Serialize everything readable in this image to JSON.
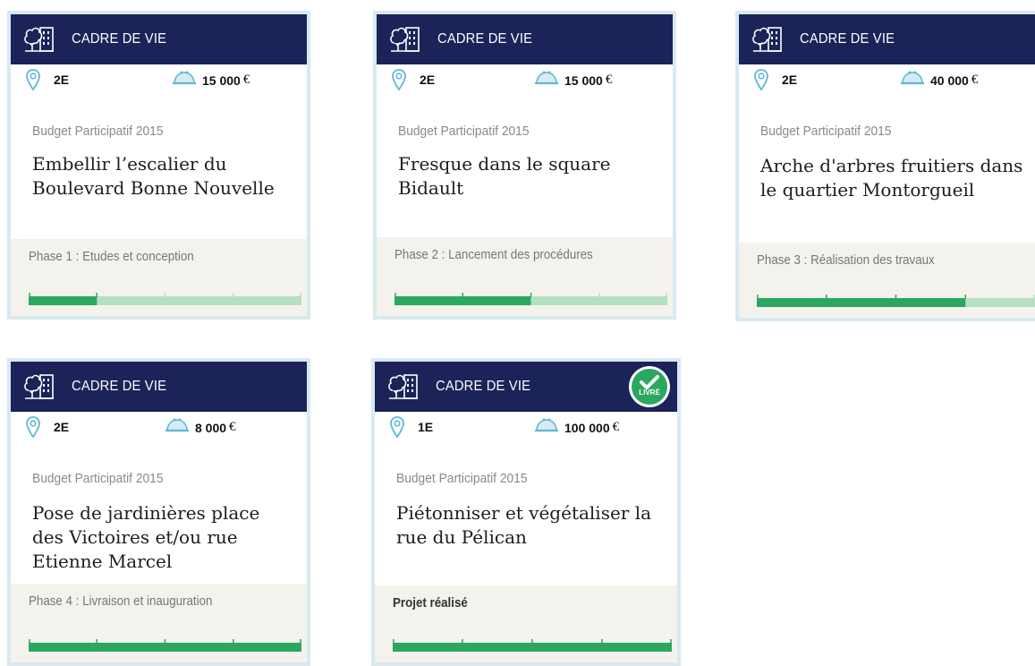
{
  "colors": {
    "header": "#1b2359",
    "accent": "#2aa860",
    "track": "#b6dfc3",
    "pin": "#5fb8d5",
    "purse": "#5fb8d5",
    "phase_bg": "#f4f2ed",
    "border": "#d7eaf0"
  },
  "icons": {
    "category": "tree-building-icon",
    "location": "map-pin-icon",
    "budget": "purse-icon",
    "delivered": "check-badge-icon"
  },
  "cards": [
    {
      "category": "CADRE DE VIE",
      "arrondissement": "2E",
      "amount": "15 000",
      "currency": "€",
      "edition": "Budget Participatif 2015",
      "title": "Embellir l’escalier du Boulevard Bonne Nouvelle",
      "phase": "Phase 1 : Etudes et conception",
      "progress_steps_done": 1,
      "progress_steps_total": 4
    },
    {
      "category": "CADRE DE VIE",
      "arrondissement": "2E",
      "amount": "15 000",
      "currency": "€",
      "edition": "Budget Participatif 2015",
      "title": "Fresque dans le square Bidault",
      "phase": "Phase 2 : Lancement des procédures",
      "progress_steps_done": 2,
      "progress_steps_total": 4
    },
    {
      "category": "CADRE DE VIE",
      "arrondissement": "2E",
      "amount": "40 000",
      "currency": "€",
      "edition": "Budget Participatif 2015",
      "title": "Arche d'arbres fruitiers dans le quartier Montorgueil",
      "phase": "Phase 3 : Réalisation des travaux",
      "progress_steps_done": 3,
      "progress_steps_total": 4
    },
    {
      "category": "CADRE DE VIE",
      "arrondissement": "2E",
      "amount": "8 000",
      "currency": "€",
      "edition": "Budget Participatif 2015",
      "title": "Pose de jardinières place des Victoires et/ou rue Etienne Marcel",
      "phase": "Phase 4 : Livraison et inauguration",
      "progress_steps_done": 4,
      "progress_steps_total": 4
    },
    {
      "category": "CADRE DE VIE",
      "arrondissement": "1E",
      "amount": "100 000",
      "currency": "€",
      "edition": "Budget Participatif 2015",
      "title": "Piétonniser et végétaliser la rue du Pélican",
      "phase": "Projet réalisé",
      "badge": "LIVRÉ",
      "progress_steps_done": 4,
      "progress_steps_total": 4
    }
  ]
}
